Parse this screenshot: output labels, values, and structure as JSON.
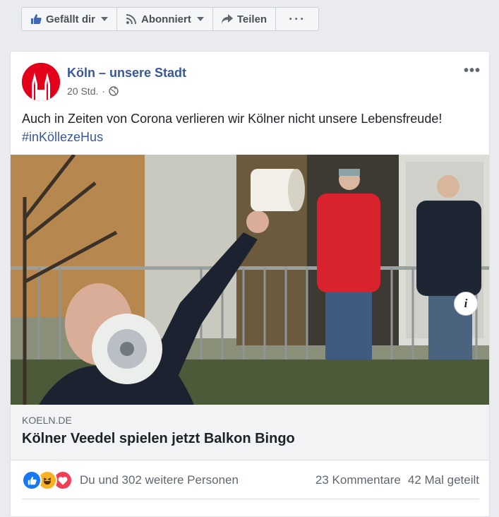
{
  "toolbar": {
    "like_label": "Gefällt dir",
    "follow_label": "Abonniert",
    "share_label": "Teilen",
    "more_label": "···"
  },
  "post": {
    "page_name": "Köln – unsere Stadt",
    "time": "20 Std.",
    "separator": "·",
    "text": "Auch in Zeiten von Corona verlieren wir Kölner nicht unsere Lebensfreude!",
    "hashtag": "#inKöllezeHus",
    "more_label": "•••"
  },
  "link_preview": {
    "domain": "KOELN.DE",
    "title": "Kölner Veedel spielen jetzt Balkon Bingo",
    "info_label": "i"
  },
  "stats": {
    "reactions_text": "Du und 302 weitere Personen",
    "comments": "23 Kommentare",
    "shares": "42 Mal geteilt"
  },
  "colors": {
    "brand_red": "#e2001a",
    "link_blue": "#385898",
    "like_blue": "#1877f2"
  }
}
